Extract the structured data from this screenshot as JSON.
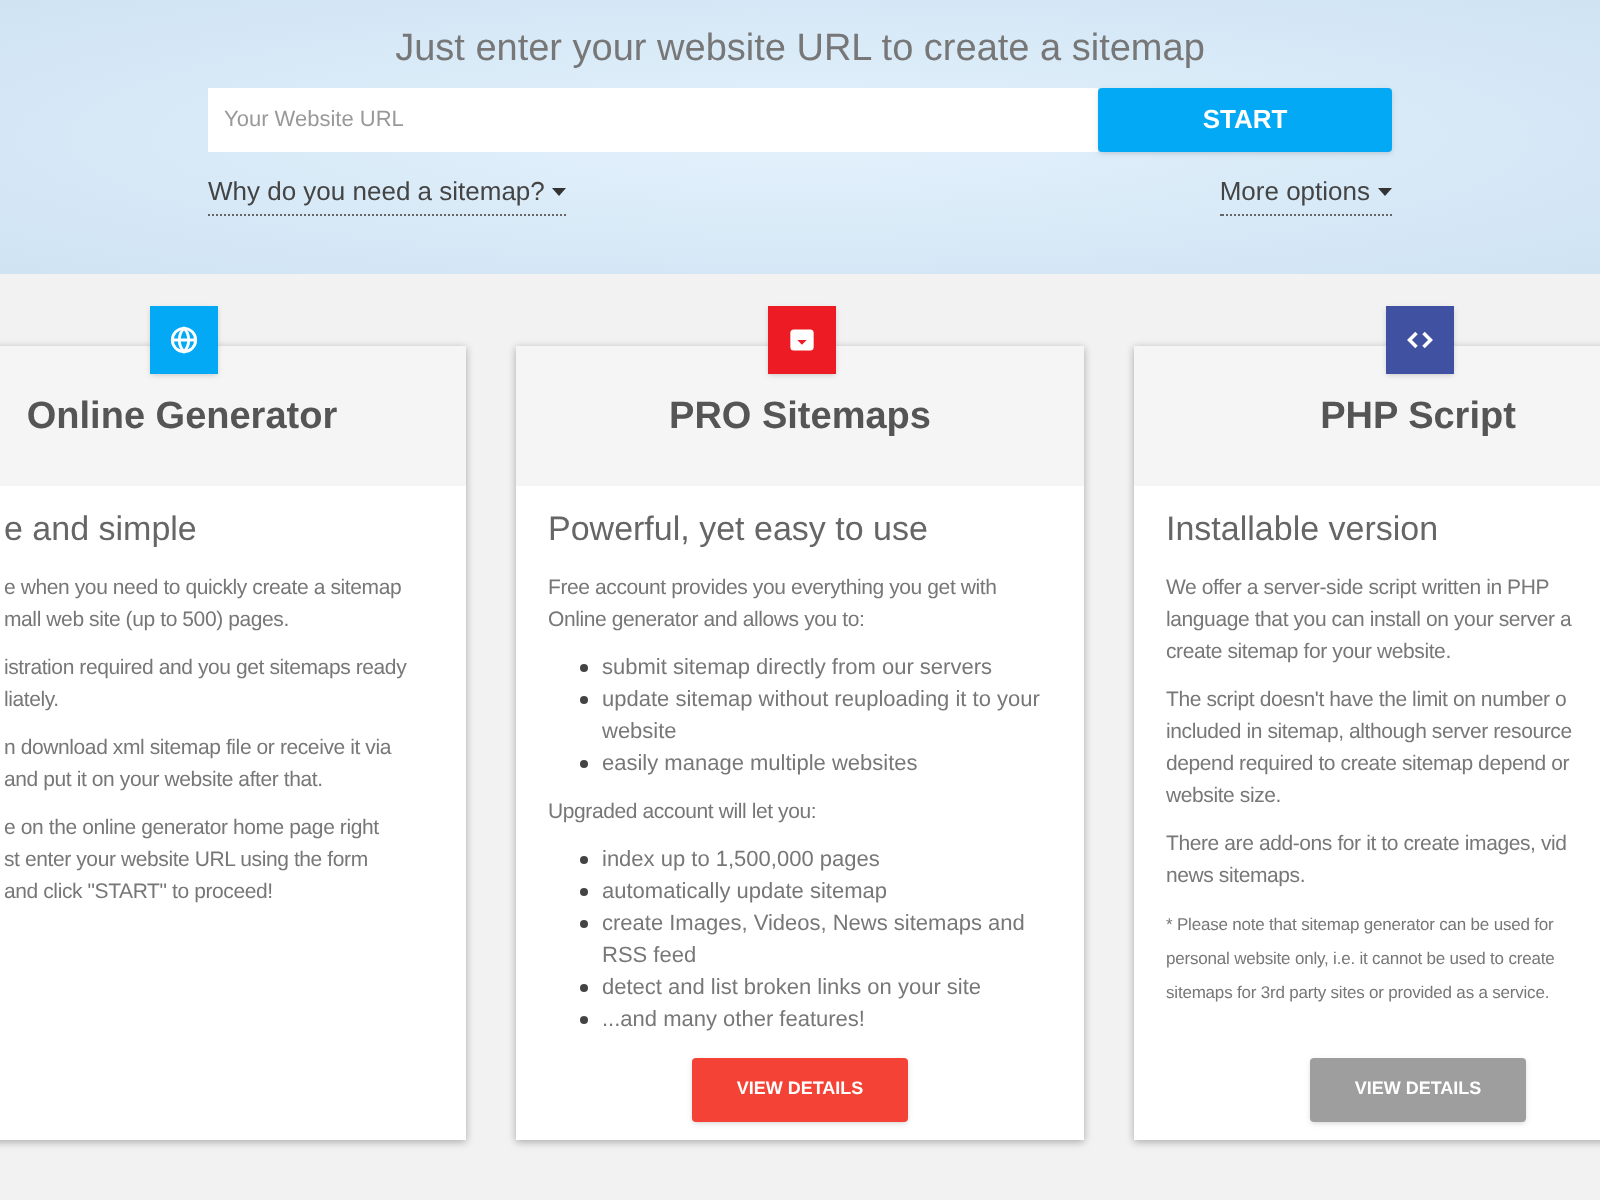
{
  "header": {
    "title": "Just enter your website URL to create a sitemap",
    "url_field": {
      "placeholder": "Your Website URL"
    },
    "start_button": "START",
    "links": [
      "Why do you need a sitemap?",
      "More options"
    ]
  },
  "cards": [
    {
      "color": "#03a9f4",
      "title": "Online Generator",
      "subtitle": "e and simple",
      "content": [
        {
          "kind": "paragraph",
          "lines": [
            "e when you need to quickly create a sitemap",
            "mall web site (up to 500) pages."
          ]
        },
        {
          "kind": "paragraph",
          "lines": [
            "istration required and you get sitemaps ready",
            "liately."
          ]
        },
        {
          "kind": "paragraph",
          "lines": [
            "n download xml sitemap file or receive it via",
            "and put it on your website after that."
          ]
        },
        {
          "kind": "paragraph",
          "lines": [
            "e on the online generator home page right",
            "st enter your website URL using the form",
            "and click \"START\" to proceed!"
          ]
        }
      ]
    },
    {
      "color": "#ed1c24",
      "title": "PRO Sitemaps",
      "subtitle": "Powerful, yet easy to use",
      "content": [
        {
          "kind": "paragraph",
          "lines": [
            "Free account provides you everything you get with",
            "Online generator and allows you to:"
          ]
        },
        {
          "kind": "list",
          "items": [
            "submit sitemap directly from our servers",
            "update sitemap without reuploading it to your website",
            "easily manage multiple websites"
          ]
        },
        {
          "kind": "paragraph",
          "lines": [
            "Upgraded account will let you:"
          ]
        },
        {
          "kind": "list",
          "items": [
            "index up to 1,500,000 pages",
            "automatically update sitemap",
            "create Images, Videos, News sitemaps and RSS feed",
            "detect and list broken links on your site",
            "...and many other features!"
          ]
        }
      ],
      "button": {
        "label": "VIEW DETAILS",
        "color": "#f44336"
      }
    },
    {
      "color": "#3f51a0",
      "title": "PHP Script",
      "subtitle": "Installable version",
      "content": [
        {
          "kind": "paragraph",
          "lines": [
            "We offer a server-side script written in PHP",
            "language that you can install on your server a",
            "create sitemap for your website."
          ]
        },
        {
          "kind": "paragraph",
          "lines": [
            "The script doesn't have the limit on number o",
            "included in sitemap, although server resource",
            "depend required to create sitemap depend or",
            "website size."
          ]
        },
        {
          "kind": "paragraph",
          "lines": [
            "There are add-ons for it to create images, vid",
            "news sitemaps."
          ]
        },
        {
          "kind": "note",
          "lines": [
            "* Please note that sitemap generator can be used for",
            "personal website only, i.e. it cannot be used to create",
            "sitemaps for 3rd party sites or provided as a service."
          ]
        }
      ],
      "button": {
        "label": "VIEW DETAILS",
        "color": "#9e9e9e"
      }
    }
  ]
}
